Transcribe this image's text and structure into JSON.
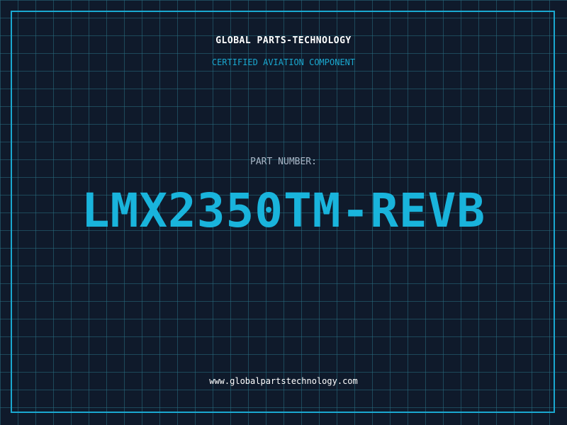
{
  "header": {
    "company": "GLOBAL PARTS-TECHNOLOGY",
    "tagline": "CERTIFIED AVIATION COMPONENT"
  },
  "part": {
    "label": "PART NUMBER:",
    "number": "LMX2350TM-REVB"
  },
  "footer": {
    "website": "www.globalpartstechnology.com"
  },
  "colors": {
    "background": "#0f1a2b",
    "accent": "#1aa8d0",
    "part_number": "#19b4dc",
    "label": "#a9b6c6",
    "text": "#ffffff"
  }
}
